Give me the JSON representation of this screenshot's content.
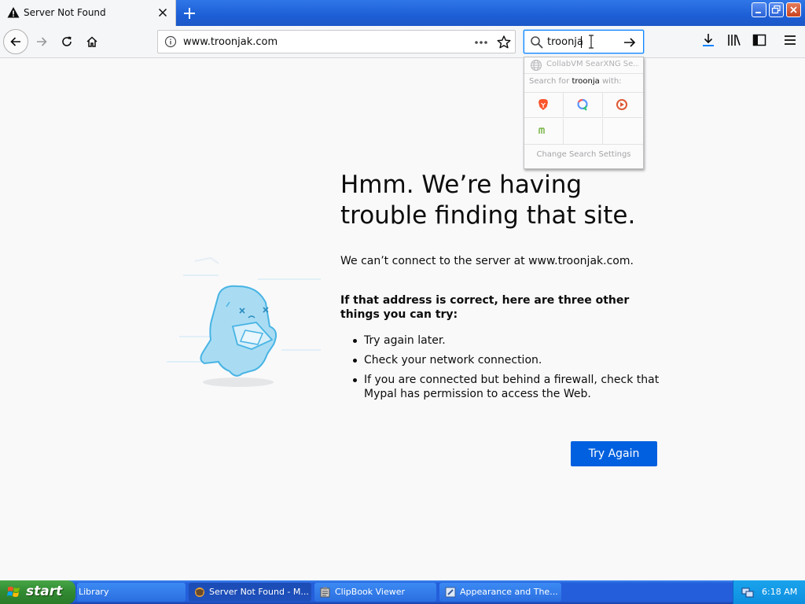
{
  "tab": {
    "title": "Server Not Found"
  },
  "nav": {
    "url": "www.troonjak.com"
  },
  "search": {
    "value": "troonja",
    "engine_name": "CollabVM SearXNG Se...",
    "search_for_prefix": "Search for",
    "search_for_term": "troonja",
    "search_for_suffix": "with:",
    "settings_label": "Change Search Settings",
    "engines": [
      "brave-icon",
      "qwant-icon",
      "duckduckgo-icon",
      "mojeek-icon"
    ]
  },
  "error": {
    "title": "Hmm. We’re having trouble finding that site.",
    "description": "We can’t connect to the server at www.troonjak.com.",
    "heading": "If that address is correct, here are three other things you can try:",
    "items": [
      "Try again later.",
      "Check your network connection.",
      "If you are connected but behind a firewall, check that Mypal has permission to access the Web."
    ],
    "button": "Try Again"
  },
  "taskbar": {
    "start": "start",
    "tasks": [
      {
        "label": "Library"
      },
      {
        "label": "Server Not Found - M..."
      },
      {
        "label": "ClipBook Viewer"
      },
      {
        "label": "Appearance and The..."
      }
    ],
    "clock": "6:18 AM"
  },
  "colors": {
    "accent": "#0060df",
    "focus": "#0a84ff",
    "taskbar": "#245edb"
  }
}
